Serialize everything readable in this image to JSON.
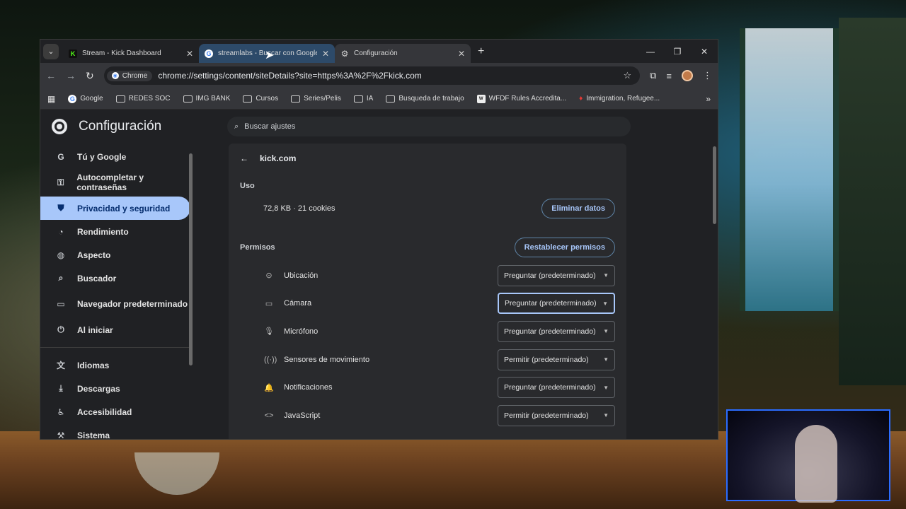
{
  "tabs": [
    {
      "title": "Stream - Kick Dashboard",
      "favicon": "kick-logo-icon"
    },
    {
      "title": "streamlabs - Buscar con Google",
      "favicon": "google-icon"
    },
    {
      "title": "Configuración",
      "favicon": "gear-icon"
    }
  ],
  "omnibox": {
    "chip": "Chrome",
    "url": "chrome://settings/content/siteDetails?site=https%3A%2F%2Fkick.com"
  },
  "bookmarks": [
    "Google",
    "REDES SOC",
    "IMG BANK",
    "Cursos",
    "Series/Pelis",
    "IA",
    "Busqueda de trabajo",
    "WFDF Rules Accredita...",
    "Immigration, Refugee..."
  ],
  "settings": {
    "title": "Configuración",
    "search_placeholder": "Buscar ajustes",
    "sidebar": [
      {
        "label": "Tú y Google",
        "icon": "google-g-icon"
      },
      {
        "label": "Autocompletar y contraseñas",
        "icon": "key-icon"
      },
      {
        "label": "Privacidad y seguridad",
        "icon": "shield-icon"
      },
      {
        "label": "Rendimiento",
        "icon": "speedometer-icon"
      },
      {
        "label": "Aspecto",
        "icon": "palette-icon"
      },
      {
        "label": "Buscador",
        "icon": "search-icon"
      },
      {
        "label": "Navegador predeterminado",
        "icon": "browser-icon"
      },
      {
        "label": "Al iniciar",
        "icon": "power-icon"
      },
      {
        "label": "Idiomas",
        "icon": "translate-icon"
      },
      {
        "label": "Descargas",
        "icon": "download-icon"
      },
      {
        "label": "Accesibilidad",
        "icon": "accessibility-icon"
      },
      {
        "label": "Sistema",
        "icon": "wrench-icon"
      }
    ],
    "site": "kick.com",
    "usage_label": "Uso",
    "usage_value": "72,8 KB · 21 cookies",
    "clear_button": "Eliminar datos",
    "permissions_label": "Permisos",
    "reset_button": "Restablecer permisos",
    "permissions": [
      {
        "name": "Ubicación",
        "value": "Preguntar (predeterminado)",
        "icon": "location-icon"
      },
      {
        "name": "Cámara",
        "value": "Preguntar (predeterminado)",
        "icon": "camera-icon"
      },
      {
        "name": "Micrófono",
        "value": "Preguntar (predeterminado)",
        "icon": "microphone-icon"
      },
      {
        "name": "Sensores de movimiento",
        "value": "Permitir (predeterminado)",
        "icon": "sensors-icon"
      },
      {
        "name": "Notificaciones",
        "value": "Preguntar (predeterminado)",
        "icon": "bell-icon"
      },
      {
        "name": "JavaScript",
        "value": "Permitir (predeterminado)",
        "icon": "code-icon"
      }
    ]
  },
  "colors": {
    "accent": "#a8c7fa",
    "panel": "#292a2d",
    "kick_green": "#53fc18"
  }
}
